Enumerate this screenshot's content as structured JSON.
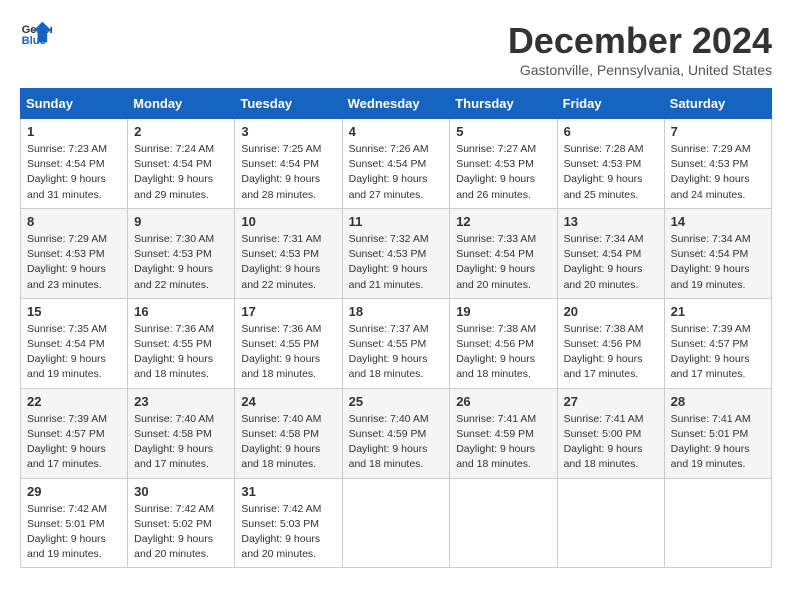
{
  "logo": {
    "line1": "General",
    "line2": "Blue"
  },
  "title": "December 2024",
  "location": "Gastonville, Pennsylvania, United States",
  "days_of_week": [
    "Sunday",
    "Monday",
    "Tuesday",
    "Wednesday",
    "Thursday",
    "Friday",
    "Saturday"
  ],
  "weeks": [
    [
      {
        "day": "1",
        "sunrise": "7:23 AM",
        "sunset": "4:54 PM",
        "daylight": "9 hours and 31 minutes."
      },
      {
        "day": "2",
        "sunrise": "7:24 AM",
        "sunset": "4:54 PM",
        "daylight": "9 hours and 29 minutes."
      },
      {
        "day": "3",
        "sunrise": "7:25 AM",
        "sunset": "4:54 PM",
        "daylight": "9 hours and 28 minutes."
      },
      {
        "day": "4",
        "sunrise": "7:26 AM",
        "sunset": "4:54 PM",
        "daylight": "9 hours and 27 minutes."
      },
      {
        "day": "5",
        "sunrise": "7:27 AM",
        "sunset": "4:53 PM",
        "daylight": "9 hours and 26 minutes."
      },
      {
        "day": "6",
        "sunrise": "7:28 AM",
        "sunset": "4:53 PM",
        "daylight": "9 hours and 25 minutes."
      },
      {
        "day": "7",
        "sunrise": "7:29 AM",
        "sunset": "4:53 PM",
        "daylight": "9 hours and 24 minutes."
      }
    ],
    [
      {
        "day": "8",
        "sunrise": "7:29 AM",
        "sunset": "4:53 PM",
        "daylight": "9 hours and 23 minutes."
      },
      {
        "day": "9",
        "sunrise": "7:30 AM",
        "sunset": "4:53 PM",
        "daylight": "9 hours and 22 minutes."
      },
      {
        "day": "10",
        "sunrise": "7:31 AM",
        "sunset": "4:53 PM",
        "daylight": "9 hours and 22 minutes."
      },
      {
        "day": "11",
        "sunrise": "7:32 AM",
        "sunset": "4:53 PM",
        "daylight": "9 hours and 21 minutes."
      },
      {
        "day": "12",
        "sunrise": "7:33 AM",
        "sunset": "4:54 PM",
        "daylight": "9 hours and 20 minutes."
      },
      {
        "day": "13",
        "sunrise": "7:34 AM",
        "sunset": "4:54 PM",
        "daylight": "9 hours and 20 minutes."
      },
      {
        "day": "14",
        "sunrise": "7:34 AM",
        "sunset": "4:54 PM",
        "daylight": "9 hours and 19 minutes."
      }
    ],
    [
      {
        "day": "15",
        "sunrise": "7:35 AM",
        "sunset": "4:54 PM",
        "daylight": "9 hours and 19 minutes."
      },
      {
        "day": "16",
        "sunrise": "7:36 AM",
        "sunset": "4:55 PM",
        "daylight": "9 hours and 18 minutes."
      },
      {
        "day": "17",
        "sunrise": "7:36 AM",
        "sunset": "4:55 PM",
        "daylight": "9 hours and 18 minutes."
      },
      {
        "day": "18",
        "sunrise": "7:37 AM",
        "sunset": "4:55 PM",
        "daylight": "9 hours and 18 minutes."
      },
      {
        "day": "19",
        "sunrise": "7:38 AM",
        "sunset": "4:56 PM",
        "daylight": "9 hours and 18 minutes."
      },
      {
        "day": "20",
        "sunrise": "7:38 AM",
        "sunset": "4:56 PM",
        "daylight": "9 hours and 17 minutes."
      },
      {
        "day": "21",
        "sunrise": "7:39 AM",
        "sunset": "4:57 PM",
        "daylight": "9 hours and 17 minutes."
      }
    ],
    [
      {
        "day": "22",
        "sunrise": "7:39 AM",
        "sunset": "4:57 PM",
        "daylight": "9 hours and 17 minutes."
      },
      {
        "day": "23",
        "sunrise": "7:40 AM",
        "sunset": "4:58 PM",
        "daylight": "9 hours and 17 minutes."
      },
      {
        "day": "24",
        "sunrise": "7:40 AM",
        "sunset": "4:58 PM",
        "daylight": "9 hours and 18 minutes."
      },
      {
        "day": "25",
        "sunrise": "7:40 AM",
        "sunset": "4:59 PM",
        "daylight": "9 hours and 18 minutes."
      },
      {
        "day": "26",
        "sunrise": "7:41 AM",
        "sunset": "4:59 PM",
        "daylight": "9 hours and 18 minutes."
      },
      {
        "day": "27",
        "sunrise": "7:41 AM",
        "sunset": "5:00 PM",
        "daylight": "9 hours and 18 minutes."
      },
      {
        "day": "28",
        "sunrise": "7:41 AM",
        "sunset": "5:01 PM",
        "daylight": "9 hours and 19 minutes."
      }
    ],
    [
      {
        "day": "29",
        "sunrise": "7:42 AM",
        "sunset": "5:01 PM",
        "daylight": "9 hours and 19 minutes."
      },
      {
        "day": "30",
        "sunrise": "7:42 AM",
        "sunset": "5:02 PM",
        "daylight": "9 hours and 20 minutes."
      },
      {
        "day": "31",
        "sunrise": "7:42 AM",
        "sunset": "5:03 PM",
        "daylight": "9 hours and 20 minutes."
      },
      null,
      null,
      null,
      null
    ]
  ],
  "labels": {
    "sunrise": "Sunrise:",
    "sunset": "Sunset:",
    "daylight": "Daylight:"
  }
}
